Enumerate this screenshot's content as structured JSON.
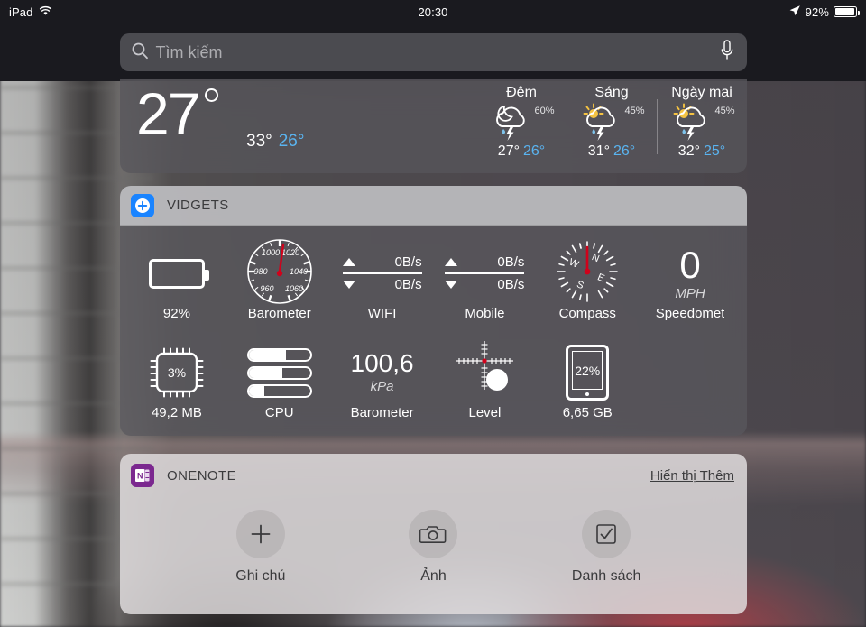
{
  "statusbar": {
    "device": "iPad",
    "wifi_icon": "wifi-icon",
    "time": "20:30",
    "location_icon": "location-arrow-icon",
    "battery_percent": "92%",
    "battery_icon": "battery-icon"
  },
  "search": {
    "placeholder": "Tìm kiếm",
    "search_icon": "search-icon",
    "mic_icon": "microphone-icon"
  },
  "weather": {
    "current_temp": "27",
    "high": "33°",
    "low": "26°",
    "forecast": [
      {
        "day": "Đêm",
        "precip": "60%",
        "high": "27°",
        "low": "26°",
        "icon": "moon-cloud-lightning-rain-icon"
      },
      {
        "day": "Sáng",
        "precip": "45%",
        "high": "31°",
        "low": "26°",
        "icon": "sun-cloud-lightning-rain-icon"
      },
      {
        "day": "Ngày mai",
        "precip": "45%",
        "high": "32°",
        "low": "25°",
        "icon": "sun-cloud-lightning-rain-icon"
      }
    ]
  },
  "widgets_panel": {
    "title": "VIDGETS",
    "app_icon": "plus-circle-icon",
    "items": [
      {
        "label": "92%",
        "kind": "battery",
        "icon": "battery-icon"
      },
      {
        "label": "Barometer",
        "kind": "gauge",
        "icon": "barometer-gauge-icon",
        "ticks": [
          "960",
          "980",
          "1000",
          "1020",
          "1040",
          "1060"
        ]
      },
      {
        "label": "WIFI",
        "kind": "network",
        "icon": "network-speed-icon",
        "up": "0B/s",
        "down": "0B/s"
      },
      {
        "label": "Mobile",
        "kind": "network",
        "icon": "network-speed-icon",
        "up": "0B/s",
        "down": "0B/s"
      },
      {
        "label": "Compass",
        "kind": "compass",
        "icon": "compass-icon",
        "cardinals": [
          "N",
          "E",
          "S",
          "W"
        ]
      },
      {
        "label": "Speedomet",
        "kind": "speed",
        "icon": "speedometer-icon",
        "value": "0",
        "unit": "MPH"
      },
      {
        "label": "49,2 MB",
        "kind": "memory",
        "icon": "memory-chip-icon",
        "value": "3%"
      },
      {
        "label": "CPU",
        "kind": "cpu",
        "icon": "cpu-bars-icon",
        "bars": [
          60,
          55,
          25
        ]
      },
      {
        "label": "Barometer",
        "kind": "pressure",
        "icon": "pressure-value-icon",
        "value": "100,6",
        "unit": "kPa"
      },
      {
        "label": "Level",
        "kind": "level",
        "icon": "level-crosshair-icon"
      },
      {
        "label": "6,65 GB",
        "kind": "storage",
        "icon": "ipad-storage-icon",
        "value": "22%"
      }
    ]
  },
  "onenote": {
    "title": "ONENOTE",
    "app_icon": "onenote-icon",
    "show_more": "Hiển thị Thêm",
    "actions": [
      {
        "label": "Ghi chú",
        "icon": "plus-icon"
      },
      {
        "label": "Ảnh",
        "icon": "camera-icon"
      },
      {
        "label": "Danh sách",
        "icon": "checkbox-icon"
      }
    ]
  },
  "colors": {
    "accent_blue": "#1a84ff",
    "low_temp_blue": "#5ab4f0",
    "onenote_purple": "#7b288f",
    "needle_red": "#d0021b"
  }
}
